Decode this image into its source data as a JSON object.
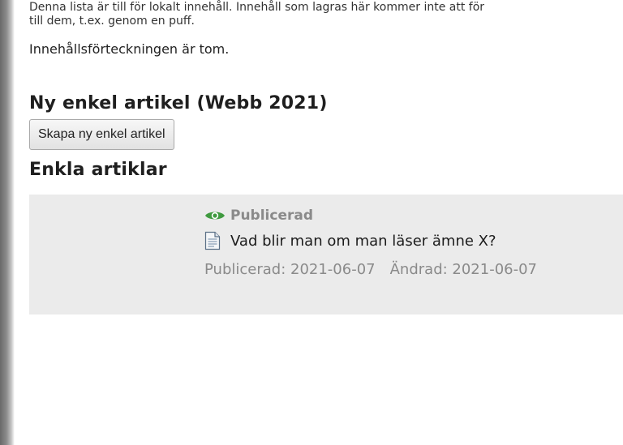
{
  "intro": {
    "line1": "Denna lista är till för lokalt innehåll. Innehåll som lagras här kommer inte att för",
    "line2": "till dem, t.ex. genom en puff."
  },
  "empty_note": "Innehållsförteckningen är tom.",
  "new_article": {
    "title": "Ny enkel artikel (Webb 2021)",
    "button_label": "Skapa ny enkel artikel"
  },
  "articles_section": {
    "title": "Enkla artiklar",
    "items": [
      {
        "status": "Publicerad",
        "status_icon": "eye-icon",
        "doc_icon": "document-icon",
        "title": "Vad blir man om man läser ämne X?",
        "published_text": "Publicerad: 2021-06-07",
        "changed_text": "Ändrad: 2021-06-07"
      }
    ]
  },
  "colors": {
    "status_green": "#3f9a3f",
    "panel_bg": "#ebebeb",
    "muted_text": "#8a8a8a"
  }
}
